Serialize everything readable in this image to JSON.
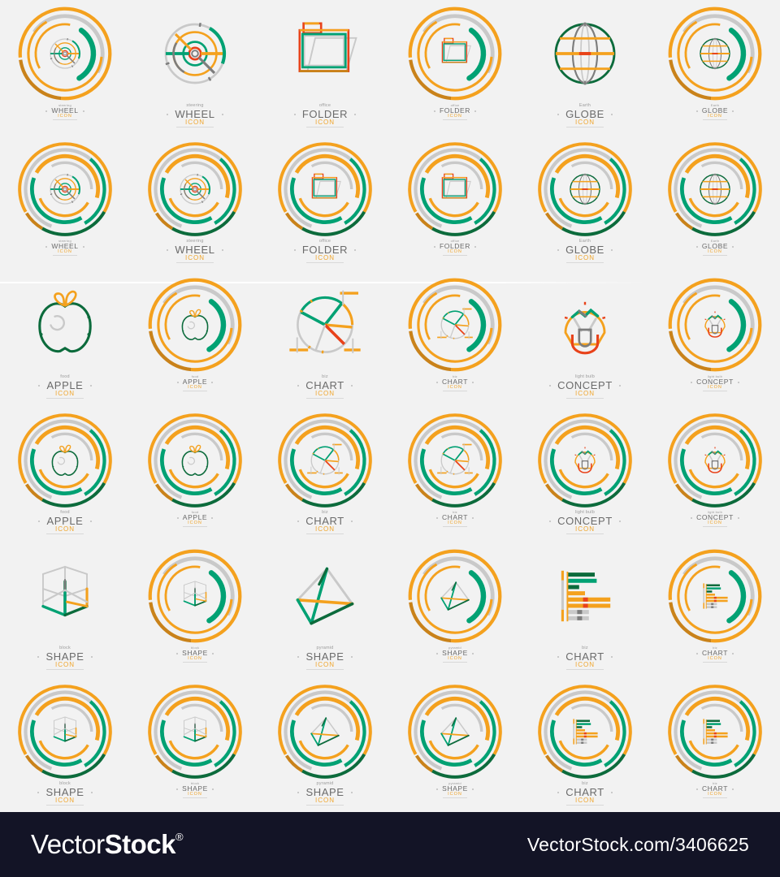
{
  "meta": {
    "background": "#f2f2f2",
    "palette": {
      "orange": "#f4a11e",
      "orange_dark": "#c9821a",
      "green": "#00a173",
      "green_dark": "#0c6b3c",
      "red": "#e8421a",
      "gray": "#c9c9c9",
      "gray_dark": "#7d7d7d",
      "label_top": "#9b9b9b",
      "label_mid": "#6b6b6b",
      "label_bot": "#f0a52b"
    }
  },
  "footer": {
    "brand_part1": "Vector",
    "brand_part2": "Stock",
    "registered": "®",
    "url": "VectorStock.com/3406625"
  },
  "labels": {
    "wheel": {
      "top": "steering",
      "mid": "WHEEL",
      "bot": "ICON"
    },
    "folder": {
      "top": "office",
      "mid": "FOLDER",
      "bot": "ICON"
    },
    "globe": {
      "top": "Earth",
      "mid": "GLOBE",
      "bot": "ICON"
    },
    "apple": {
      "top": "food",
      "mid": "APPLE",
      "bot": "ICON"
    },
    "chart": {
      "top": "biz",
      "mid": "CHART",
      "bot": "ICON"
    },
    "bulb": {
      "top": "light bulb",
      "mid": "CONCEPT",
      "bot": "ICON"
    },
    "block": {
      "top": "block",
      "mid": "SHAPE",
      "bot": "ICON"
    },
    "pyramid": {
      "top": "pyramid",
      "mid": "SHAPE",
      "bot": "ICON"
    }
  },
  "grid": {
    "columns": 6,
    "rows": 6,
    "cells": [
      {
        "r": 1,
        "c": 1,
        "glyph": "wheel",
        "label": "wheel",
        "size": "sml",
        "rings": "a"
      },
      {
        "r": 1,
        "c": 2,
        "glyph": "wheel",
        "label": "wheel",
        "size": "big",
        "rings": "none"
      },
      {
        "r": 1,
        "c": 3,
        "glyph": "folder",
        "label": "folder",
        "size": "big",
        "rings": "none"
      },
      {
        "r": 1,
        "c": 4,
        "glyph": "folder",
        "label": "folder",
        "size": "sml",
        "rings": "a"
      },
      {
        "r": 1,
        "c": 5,
        "glyph": "globe",
        "label": "globe",
        "size": "big",
        "rings": "none"
      },
      {
        "r": 1,
        "c": 6,
        "glyph": "globe",
        "label": "globe",
        "size": "sml",
        "rings": "a"
      },
      {
        "r": 2,
        "c": 1,
        "glyph": "wheel",
        "label": "wheel",
        "size": "sml",
        "rings": "b"
      },
      {
        "r": 2,
        "c": 2,
        "glyph": "wheel",
        "label": "wheel",
        "size": "big",
        "rings": "b"
      },
      {
        "r": 2,
        "c": 3,
        "glyph": "folder",
        "label": "folder",
        "size": "big",
        "rings": "b"
      },
      {
        "r": 2,
        "c": 4,
        "glyph": "folder",
        "label": "folder",
        "size": "sml",
        "rings": "b"
      },
      {
        "r": 2,
        "c": 5,
        "glyph": "globe",
        "label": "globe",
        "size": "big",
        "rings": "b"
      },
      {
        "r": 2,
        "c": 6,
        "glyph": "globe",
        "label": "globe",
        "size": "sml",
        "rings": "b"
      },
      {
        "r": 3,
        "c": 1,
        "glyph": "apple",
        "label": "apple",
        "size": "big",
        "rings": "none"
      },
      {
        "r": 3,
        "c": 2,
        "glyph": "apple",
        "label": "apple",
        "size": "sml",
        "rings": "a"
      },
      {
        "r": 3,
        "c": 3,
        "glyph": "pie",
        "label": "chart",
        "size": "big",
        "rings": "none"
      },
      {
        "r": 3,
        "c": 4,
        "glyph": "pie",
        "label": "chart",
        "size": "sml",
        "rings": "a"
      },
      {
        "r": 3,
        "c": 5,
        "glyph": "bulb",
        "label": "bulb",
        "size": "big",
        "rings": "none"
      },
      {
        "r": 3,
        "c": 6,
        "glyph": "bulb",
        "label": "bulb",
        "size": "sml",
        "rings": "a"
      },
      {
        "r": 4,
        "c": 1,
        "glyph": "apple",
        "label": "apple",
        "size": "big",
        "rings": "b"
      },
      {
        "r": 4,
        "c": 2,
        "glyph": "apple",
        "label": "apple",
        "size": "sml",
        "rings": "b"
      },
      {
        "r": 4,
        "c": 3,
        "glyph": "pie",
        "label": "chart",
        "size": "big",
        "rings": "b"
      },
      {
        "r": 4,
        "c": 4,
        "glyph": "pie",
        "label": "chart",
        "size": "sml",
        "rings": "b"
      },
      {
        "r": 4,
        "c": 5,
        "glyph": "bulb",
        "label": "bulb",
        "size": "big",
        "rings": "b"
      },
      {
        "r": 4,
        "c": 6,
        "glyph": "bulb",
        "label": "bulb",
        "size": "sml",
        "rings": "b"
      },
      {
        "r": 5,
        "c": 1,
        "glyph": "block",
        "label": "block",
        "size": "big",
        "rings": "none"
      },
      {
        "r": 5,
        "c": 2,
        "glyph": "block",
        "label": "block",
        "size": "sml",
        "rings": "a"
      },
      {
        "r": 5,
        "c": 3,
        "glyph": "pyramid",
        "label": "pyramid",
        "size": "big",
        "rings": "none"
      },
      {
        "r": 5,
        "c": 4,
        "glyph": "pyramid",
        "label": "pyramid",
        "size": "sml",
        "rings": "a"
      },
      {
        "r": 5,
        "c": 5,
        "glyph": "bars",
        "label": "chart",
        "size": "big",
        "rings": "none"
      },
      {
        "r": 5,
        "c": 6,
        "glyph": "bars",
        "label": "chart",
        "size": "sml",
        "rings": "a"
      },
      {
        "r": 6,
        "c": 1,
        "glyph": "block",
        "label": "block",
        "size": "big",
        "rings": "b"
      },
      {
        "r": 6,
        "c": 2,
        "glyph": "block",
        "label": "block",
        "size": "sml",
        "rings": "b"
      },
      {
        "r": 6,
        "c": 3,
        "glyph": "pyramid",
        "label": "pyramid",
        "size": "big",
        "rings": "b"
      },
      {
        "r": 6,
        "c": 4,
        "glyph": "pyramid",
        "label": "pyramid",
        "size": "sml",
        "rings": "b"
      },
      {
        "r": 6,
        "c": 5,
        "glyph": "bars",
        "label": "chart",
        "size": "big",
        "rings": "b"
      },
      {
        "r": 6,
        "c": 6,
        "glyph": "bars",
        "label": "chart",
        "size": "sml",
        "rings": "b"
      }
    ]
  }
}
